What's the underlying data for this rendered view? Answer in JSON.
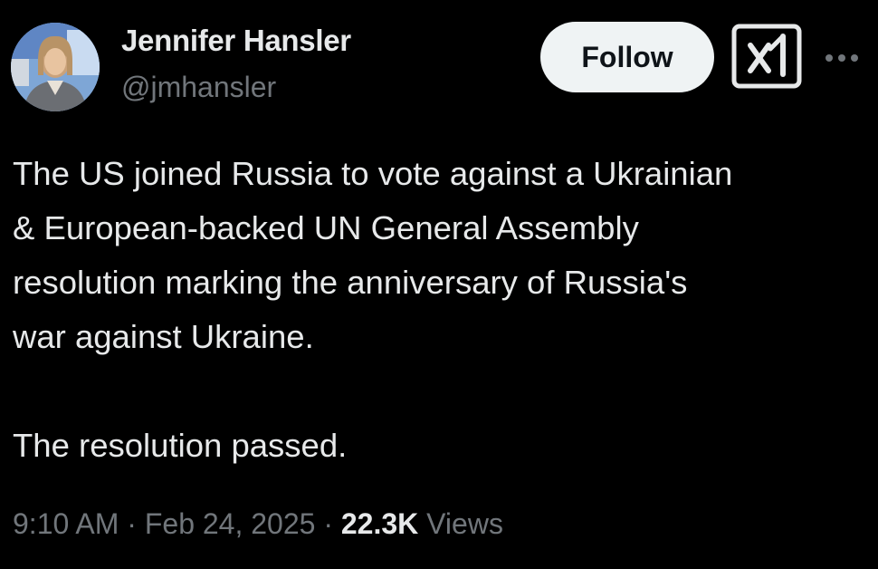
{
  "author": {
    "display_name": "Jennifer Hansler",
    "handle": "@jmhansler"
  },
  "actions": {
    "follow_label": "Follow",
    "grok_icon": "grok-icon",
    "more_icon": "more-horizontal-icon"
  },
  "tweet": {
    "paragraph_1_lines": [
      "The US joined Russia to vote against a Ukrainian",
      "& European-backed UN General Assembly",
      "resolution marking the anniversary of Russia's",
      "war against Ukraine."
    ],
    "paragraph_2": "The resolution passed."
  },
  "meta": {
    "time": "9:10 AM",
    "separator": "·",
    "date": "Feb 24, 2025",
    "views_count": "22.3K",
    "views_label": "Views"
  },
  "colors": {
    "background": "#000000",
    "primary_text": "#e7e9ea",
    "secondary_text": "#71767b",
    "follow_bg": "#eff3f4",
    "follow_text": "#0f1419"
  }
}
